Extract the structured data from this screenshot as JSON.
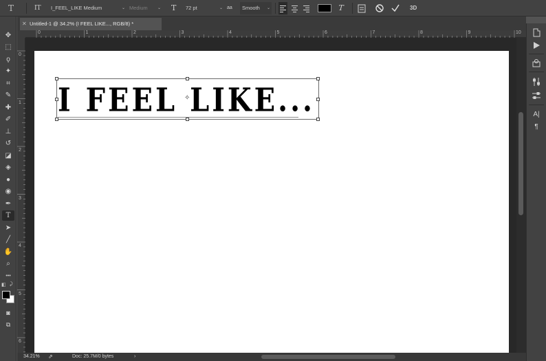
{
  "options_bar": {
    "tool_icon": "T",
    "orientation_icon": "IT",
    "font_family": "I_FEEL_LIKE Medium",
    "font_style": "Medium",
    "size_icon": "T",
    "font_size": "72 pt",
    "aa_icon": "aa",
    "anti_alias": "Smooth",
    "text_color": "#000000",
    "warp_icon": "T",
    "panels_icon": "panels",
    "cancel_icon": "cancel",
    "commit_icon": "commit",
    "threed_label": "3D"
  },
  "document": {
    "tab_title": "Untitled-1 @ 34.2% (I FEEL LIKE..., RGB/8) *",
    "canvas_text": "I FEEL LIKE...",
    "canvas_background": "#ffffff"
  },
  "ruler": {
    "horizontal_labels": [
      "0",
      "1",
      "2",
      "3",
      "4",
      "5",
      "6",
      "7",
      "8",
      "9",
      "10"
    ],
    "vertical_labels": [
      "0",
      "1",
      "2",
      "3",
      "4",
      "5",
      "6"
    ]
  },
  "tools": [
    {
      "name": "move-tool",
      "glyph": "✥"
    },
    {
      "name": "marquee-tool",
      "glyph": "⬚"
    },
    {
      "name": "lasso-tool",
      "glyph": "ϙ"
    },
    {
      "name": "magic-wand-tool",
      "glyph": "✦"
    },
    {
      "name": "crop-tool",
      "glyph": "⌗"
    },
    {
      "name": "eyedropper-tool",
      "glyph": "✎"
    },
    {
      "name": "healing-brush-tool",
      "glyph": "✚"
    },
    {
      "name": "brush-tool",
      "glyph": "✐"
    },
    {
      "name": "clone-stamp-tool",
      "glyph": "⊥"
    },
    {
      "name": "history-brush-tool",
      "glyph": "↺"
    },
    {
      "name": "eraser-tool",
      "glyph": "◪"
    },
    {
      "name": "paint-bucket-tool",
      "glyph": "◈"
    },
    {
      "name": "blur-tool",
      "glyph": "●"
    },
    {
      "name": "dodge-tool",
      "glyph": "◉"
    },
    {
      "name": "pen-tool",
      "glyph": "✒"
    },
    {
      "name": "type-tool",
      "glyph": "T"
    },
    {
      "name": "path-selection-tool",
      "glyph": "➤"
    },
    {
      "name": "line-tool",
      "glyph": "╱"
    },
    {
      "name": "hand-tool",
      "glyph": "✋"
    },
    {
      "name": "zoom-tool",
      "glyph": "⌕"
    },
    {
      "name": "more-tools",
      "glyph": "•••"
    }
  ],
  "active_tool": "type-tool",
  "colors": {
    "foreground": "#000000",
    "background": "#ffffff"
  },
  "right_panel": {
    "icons": [
      "history-icon",
      "play-actions-icon",
      "libraries-icon",
      "adjustments-icon",
      "properties-icon",
      "character-icon",
      "paragraph-icon"
    ],
    "character_label": "A|",
    "paragraph_label": "¶"
  },
  "status_bar": {
    "zoom": "34.21%",
    "doc_info": "Doc: 25.7M/0 bytes",
    "arrow": "›"
  }
}
